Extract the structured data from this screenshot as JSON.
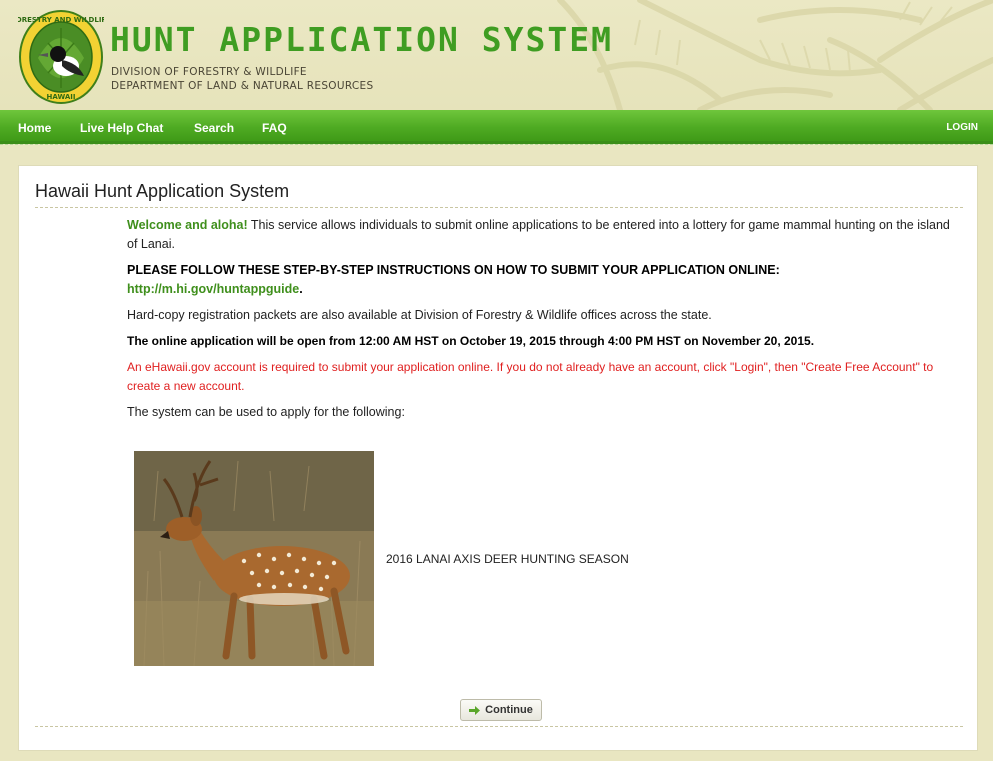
{
  "header": {
    "title": "HUNT APPLICATION SYSTEM",
    "subtitle_line1": "DIVISION OF FORESTRY & WILDLIFE",
    "subtitle_line2": "DEPARTMENT OF LAND & NATURAL RESOURCES",
    "logo_text_top": "FORESTRY AND WILDLIFE",
    "logo_text_bottom": "HAWAII"
  },
  "nav": {
    "items": [
      {
        "label": "Home"
      },
      {
        "label": "Live Help Chat"
      },
      {
        "label": "Search"
      },
      {
        "label": "FAQ"
      }
    ],
    "login": "LOGIN"
  },
  "main": {
    "title": "Hawaii Hunt Application System",
    "welcome_lead": "Welcome and aloha!",
    "welcome_text": " This service allows individuals to submit online applications to be entered into a lottery for game mammal hunting on the island of Lanai.",
    "instructions": "PLEASE FOLLOW THESE STEP-BY-STEP INSTRUCTIONS ON HOW TO SUBMIT YOUR APPLICATION ONLINE:",
    "guide_link": "http://m.hi.gov/huntappguide",
    "guide_period": ".",
    "hardcopy": "Hard-copy registration packets are also available at Division of Forestry & Wildlife offices across the state.",
    "open_dates": "The online application will be open from 12:00 AM HST on October 19, 2015 through 4:00 PM HST on November 20, 2015.",
    "notice": "An eHawaii.gov account is required to submit your application online. If you do not already have an account, click \"Login\", then \"Create Free Account\" to create a new account.",
    "apply_intro": "The system can be used to apply for the following:",
    "season_label": "2016 LANAI AXIS DEER HUNTING SEASON",
    "continue_label": "Continue"
  },
  "colors": {
    "accent_green": "#3f9d22",
    "nav_green": "#4fab23",
    "notice_red": "#e02020",
    "background": "#e9e6c1"
  }
}
